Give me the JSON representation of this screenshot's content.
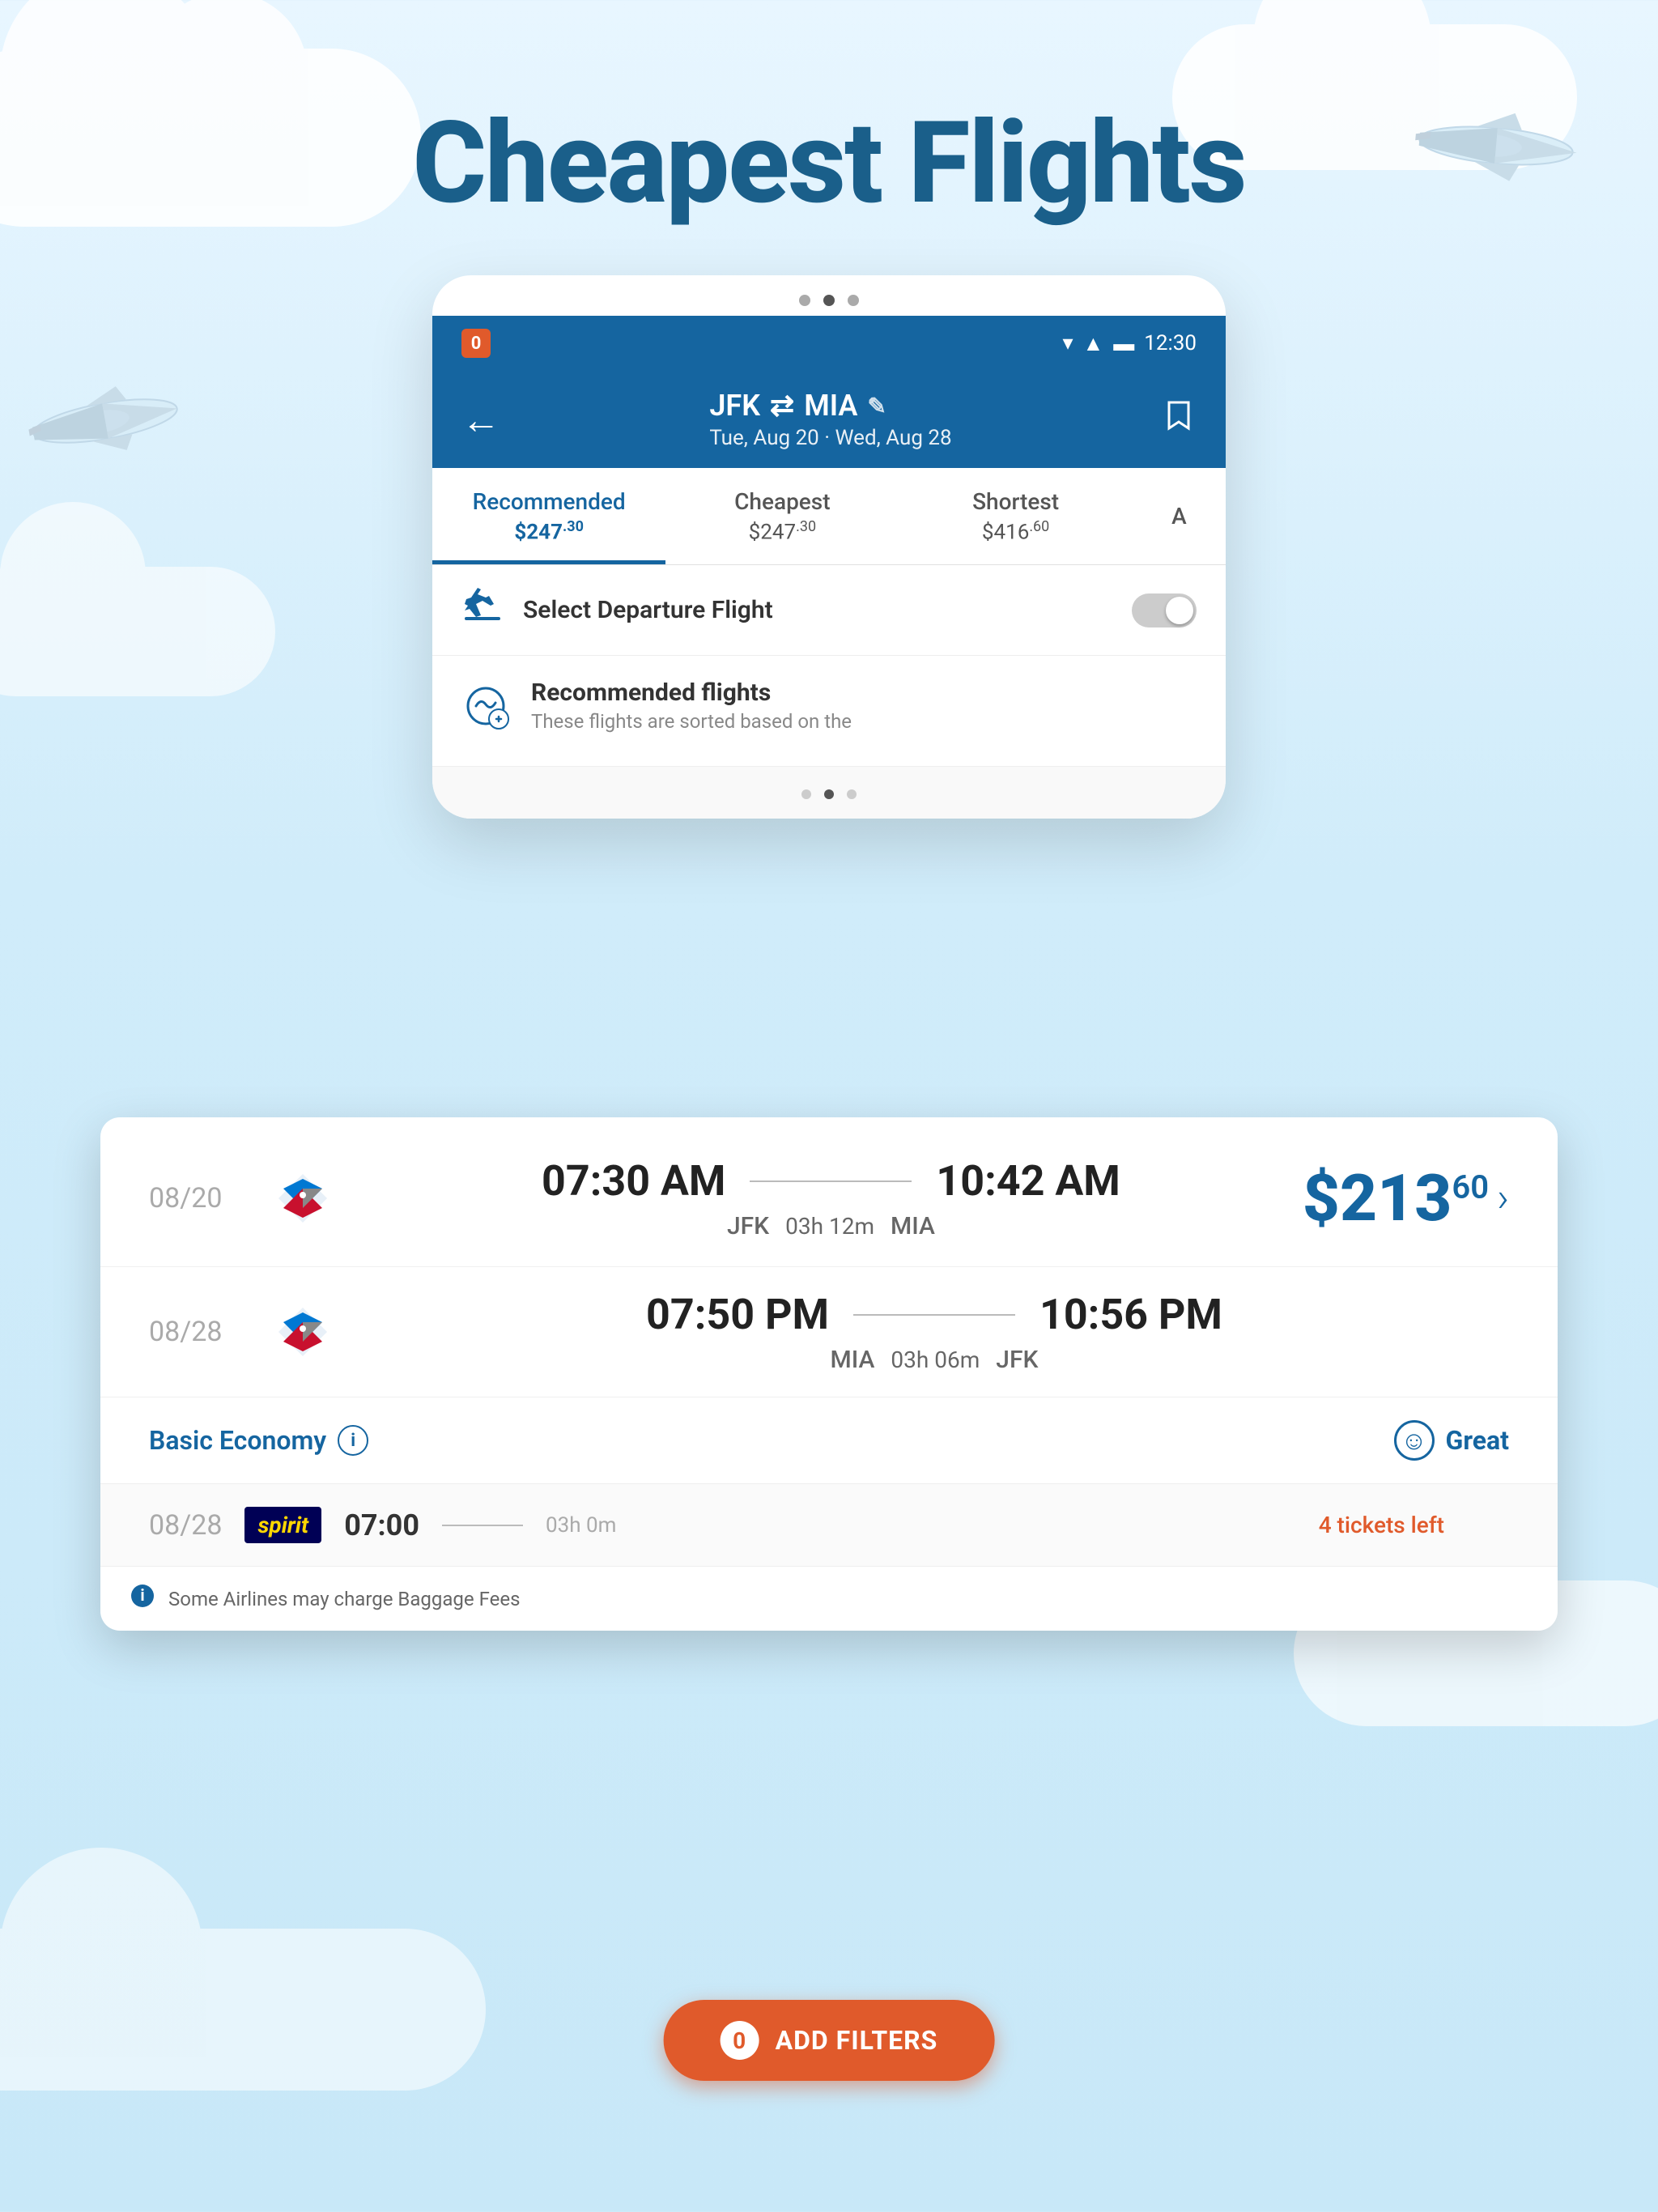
{
  "page": {
    "title": "Cheapest Flights",
    "background_color": "#d4edf8"
  },
  "header": {
    "notification_count": "0",
    "time": "12:30",
    "back_label": "←",
    "route_from": "JFK",
    "route_arrow": "⇄",
    "route_to": "MIA",
    "edit_icon": "✎",
    "dates": "Tue, Aug 20 · Wed, Aug 28",
    "bookmark_icon": "⊡"
  },
  "tabs": [
    {
      "label": "Recommended",
      "price": "$247",
      "cents": "30",
      "active": true
    },
    {
      "label": "Cheapest",
      "price": "$247",
      "cents": "30",
      "active": false
    },
    {
      "label": "Shortest",
      "price": "$416",
      "cents": "60",
      "active": false
    },
    {
      "label": "A",
      "price": "",
      "cents": "",
      "active": false
    }
  ],
  "select_departure": {
    "label": "Select Departure Flight",
    "toggle_state": "off"
  },
  "recommended_section": {
    "title": "Recommended flights",
    "subtitle": "These flights are sorted based on the"
  },
  "flight_card": {
    "flights": [
      {
        "date": "08/20",
        "airline": "American Airlines",
        "depart_time": "07:30 AM",
        "arrive_time": "10:42 AM",
        "origin": "JFK",
        "duration": "03h 12m",
        "destination": "MIA"
      },
      {
        "date": "08/28",
        "airline": "American Airlines",
        "depart_time": "07:50 PM",
        "arrive_time": "10:56 PM",
        "origin": "MIA",
        "duration": "03h 06m",
        "destination": "JFK"
      }
    ],
    "price": "$213",
    "price_cents": "60",
    "price_arrow": ">",
    "cabin_class": "Basic Economy",
    "rating_label": "Great"
  },
  "spirit_row": {
    "date": "08/28",
    "airline": "spirit",
    "depart_time": "07:00",
    "duration": "03h 0m",
    "tickets_left_label": "4 tickets left"
  },
  "baggage": {
    "note": "Some Airlines may charge Baggage Fees"
  },
  "add_filters": {
    "badge": "0",
    "label": "ADD FILTERS"
  },
  "dots": {
    "top": [
      "inactive",
      "active",
      "inactive"
    ],
    "bottom": [
      "inactive",
      "active",
      "inactive"
    ]
  }
}
